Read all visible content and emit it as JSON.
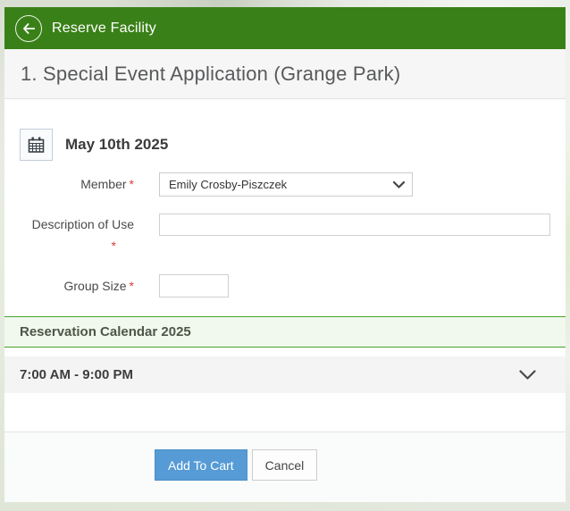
{
  "colors": {
    "header_green": "#3a8018",
    "section_border_green": "#44a52a",
    "primary_button_blue": "#569bd5",
    "required_marker_red": "#d43f3a"
  },
  "header": {
    "title": "Reserve Facility",
    "back_icon": "back-arrow-icon"
  },
  "page": {
    "title": "1. Special Event Application (Grange Park)"
  },
  "date_row": {
    "icon": "calendar-icon",
    "date": "May 10th 2025"
  },
  "form": {
    "required_marker": "*",
    "fields": [
      {
        "label": "Member",
        "required": true,
        "type": "select",
        "value": "Emily Crosby-Piszczek"
      },
      {
        "label": "Description of Use",
        "required": true,
        "type": "text",
        "value": ""
      },
      {
        "label": "Group Size",
        "required": true,
        "type": "text",
        "value": ""
      }
    ]
  },
  "sections": {
    "reservation_calendar": {
      "title": "Reservation Calendar 2025"
    },
    "time_slot": {
      "label": "7:00 AM - 9:00 PM",
      "expanded": false,
      "icon": "chevron-down-icon"
    }
  },
  "footer": {
    "add_to_cart_label": "Add To Cart",
    "cancel_label": "Cancel"
  }
}
